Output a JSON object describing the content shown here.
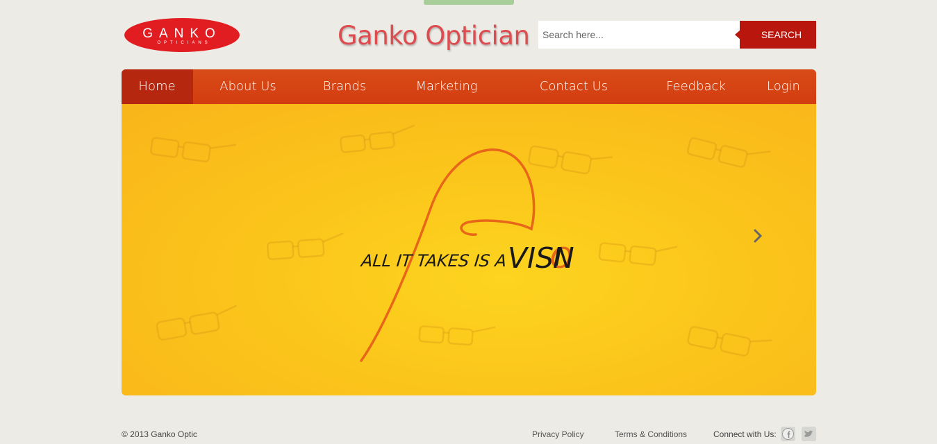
{
  "header": {
    "logo_name": "GANKO",
    "logo_sub": "OPTICIANS",
    "title": "Ganko Optician"
  },
  "search": {
    "placeholder": "Search here...",
    "button_label": "SEARCH"
  },
  "nav": {
    "items": [
      {
        "label": "Home",
        "active": true
      },
      {
        "label": "About Us"
      },
      {
        "label": "Brands"
      },
      {
        "label": "Marketing"
      },
      {
        "label": "Contact Us"
      },
      {
        "label": "Feedback"
      },
      {
        "label": "Login"
      }
    ]
  },
  "hero": {
    "tagline_prefix": "ALL IT TAKES IS A",
    "tagline_word_start": "VISI",
    "tagline_word_o": "O",
    "tagline_word_end": "N"
  },
  "footer": {
    "copyright": "© 2013 Ganko Optic",
    "privacy": "Privacy Policy",
    "terms": "Terms & Conditions",
    "connect": "Connect with Us:"
  },
  "icons": [
    "facebook-icon",
    "twitter-icon",
    "chevron-right-icon"
  ],
  "colors": {
    "brand_red": "#b9170e",
    "nav_orange": "#d84b18",
    "title_red": "#de4c4f",
    "hero_yellow": "#fbc51b"
  }
}
